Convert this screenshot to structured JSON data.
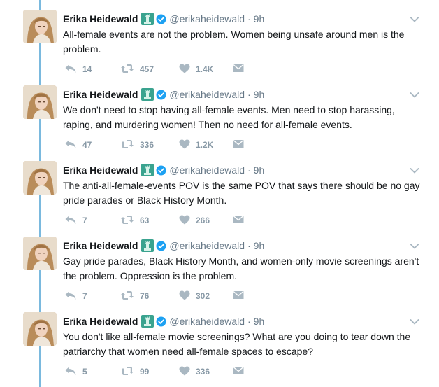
{
  "author": {
    "name": "Erika Heidewald",
    "handle": "@erikaheidewald"
  },
  "icons": {
    "reply": "reply-icon",
    "retweet": "retweet-icon",
    "like": "heart-icon",
    "dm": "envelope-icon",
    "emoji": "statue-of-liberty-emoji",
    "verified": "verified-badge-icon",
    "menu": "chevron-down-icon"
  },
  "colors": {
    "thread_line": "#7ab9de",
    "verified": "#1da1f2",
    "muted": "#8899a6"
  },
  "tweets": [
    {
      "time": "9h",
      "text": "All-female events are not the problem. Women being unsafe around men is the problem.",
      "replies": "14",
      "retweets": "457",
      "likes": "1.4K"
    },
    {
      "time": "9h",
      "text": "We don't need to stop having all-female events. Men need to stop harassing, raping, and murdering women! Then no need for all-female events.",
      "replies": "47",
      "retweets": "336",
      "likes": "1.2K"
    },
    {
      "time": "9h",
      "text": "The anti-all-female-events POV is the same POV that says there should be no gay pride parades or Black History Month.",
      "replies": "7",
      "retweets": "63",
      "likes": "266"
    },
    {
      "time": "9h",
      "text": "Gay pride parades, Black History Month, and women-only movie screenings aren't the problem. Oppression is the problem.",
      "replies": "7",
      "retweets": "76",
      "likes": "302"
    },
    {
      "time": "9h",
      "text": "You don't like all-female movie screenings? What are you doing to tear down the patriarchy that women need all-female spaces to escape?",
      "replies": "5",
      "retweets": "99",
      "likes": "336"
    }
  ]
}
